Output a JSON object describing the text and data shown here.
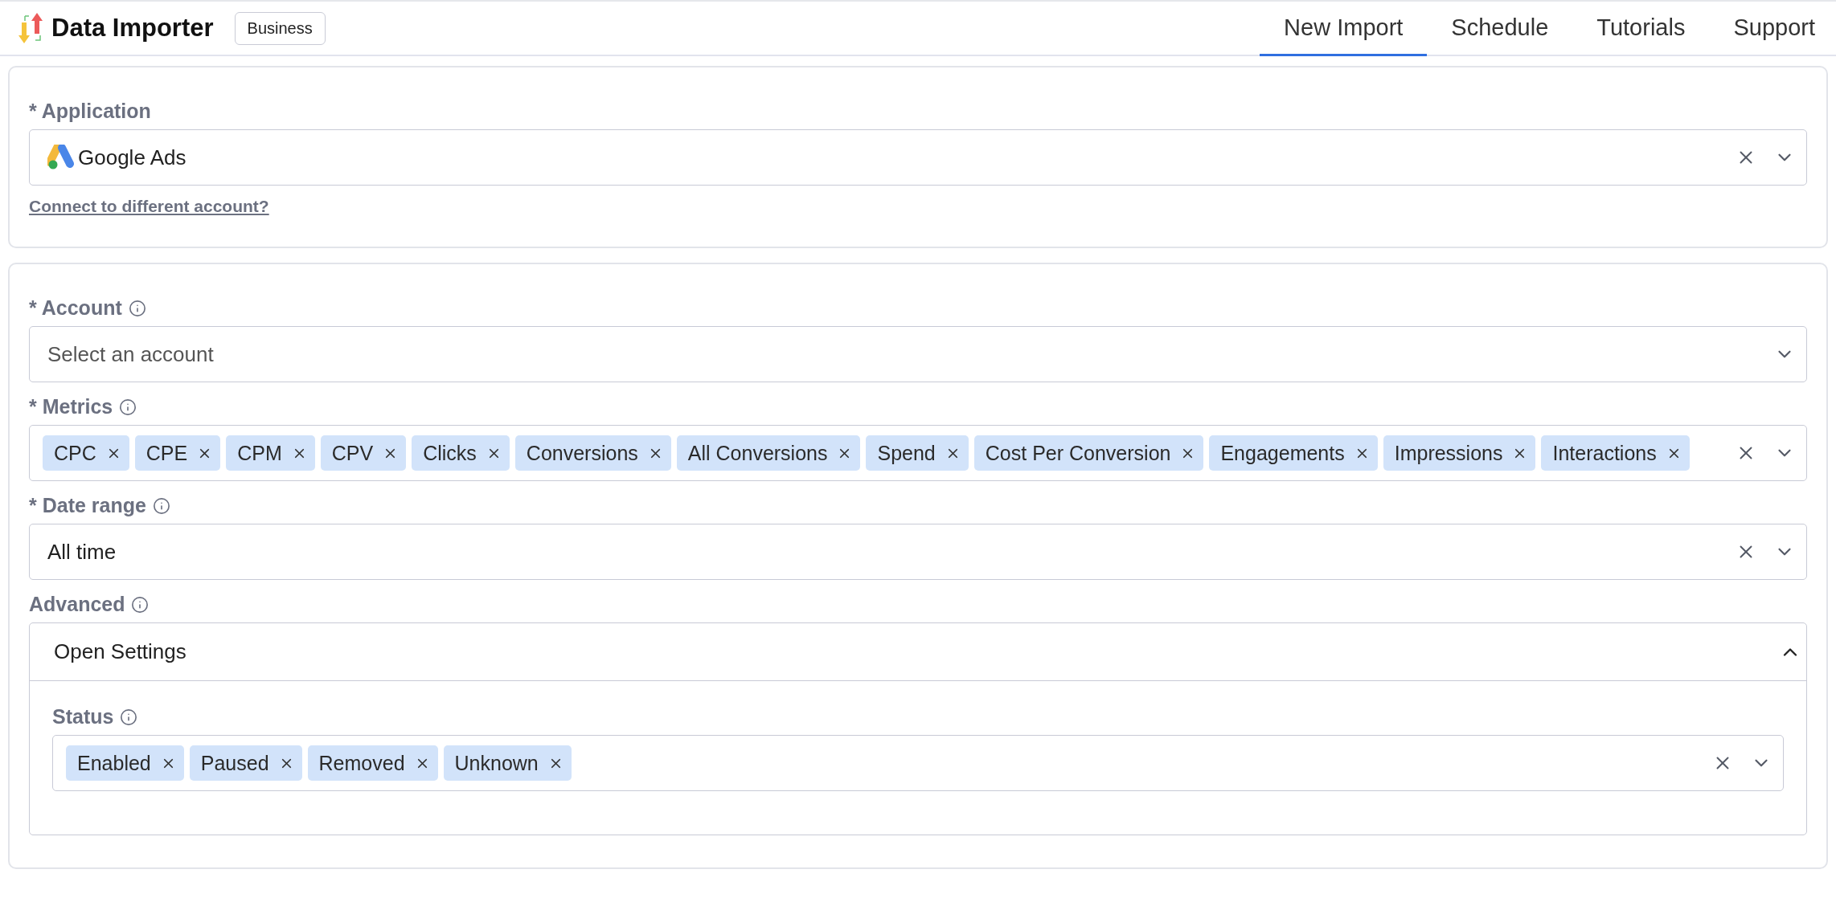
{
  "header": {
    "brand": "Data Importer",
    "plan": "Business",
    "tabs": [
      {
        "label": "New Import",
        "selected": true
      },
      {
        "label": "Schedule",
        "selected": false
      },
      {
        "label": "Tutorials",
        "selected": false
      },
      {
        "label": "Support",
        "selected": false
      }
    ]
  },
  "application": {
    "label": "* Application",
    "value": "Google Ads",
    "link": "Connect to different account?"
  },
  "fields": [
    {
      "kind": "select",
      "label": "* Account",
      "info": true,
      "placeholder": "Select an account",
      "clearable": false
    },
    {
      "kind": "tags",
      "label": "* Metrics",
      "info": true,
      "clearable": true,
      "tags": [
        "CPC",
        "CPE",
        "CPM",
        "CPV",
        "Clicks",
        "Conversions",
        "All Conversions",
        "Spend",
        "Cost Per Conversion",
        "Engagements",
        "Impressions",
        "Interactions"
      ]
    },
    {
      "kind": "select",
      "label": "* Date range",
      "info": true,
      "value": "All time",
      "clearable": true
    },
    {
      "kind": "collapse",
      "label": "Advanced",
      "info": true,
      "header": "Open Settings",
      "expanded": true,
      "children": [
        {
          "kind": "tags",
          "label": "Status",
          "info": true,
          "clearable": true,
          "tags": [
            "Enabled",
            "Paused",
            "Removed",
            "Unknown"
          ]
        }
      ]
    }
  ]
}
